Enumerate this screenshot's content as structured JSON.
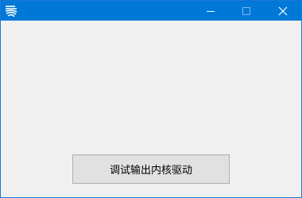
{
  "window": {
    "title": "",
    "icons": {
      "app": "app-logo-icon",
      "minimize": "minimize-icon",
      "maximize": "maximize-icon",
      "close": "close-icon"
    },
    "colors": {
      "titlebar": "#0078d7",
      "border": "#1a79d2",
      "client": "#f0f0f0",
      "button_face": "#e1e1e1",
      "button_border": "#adadad"
    }
  },
  "main": {
    "action_button_label": "调试输出内核驱动"
  }
}
